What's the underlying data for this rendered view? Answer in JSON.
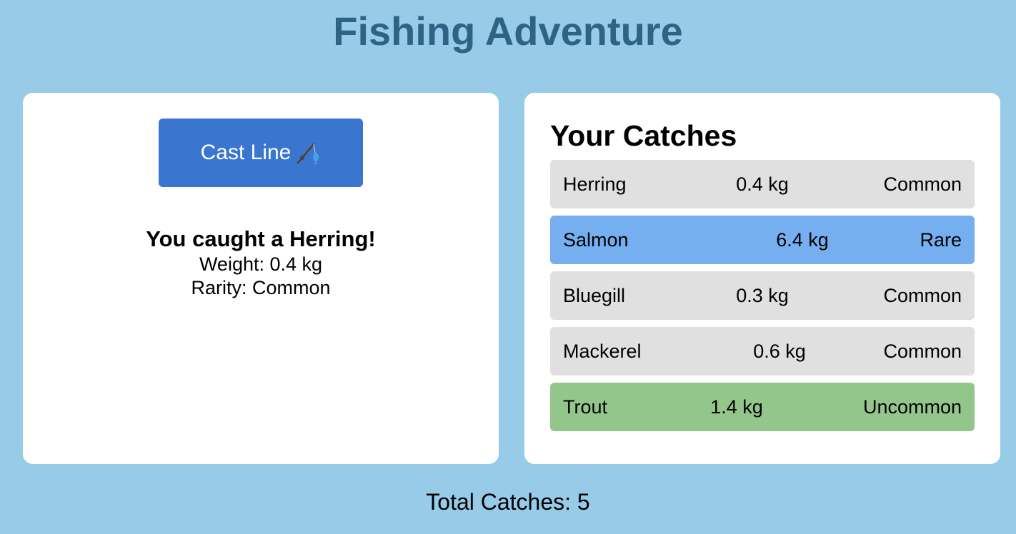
{
  "app": {
    "title": "Fishing Adventure"
  },
  "cast_panel": {
    "button_label": "Cast Line",
    "button_icon": "fishing-rod-icon",
    "button_color": "#3a76d0",
    "result": {
      "heading": "You caught a Herring!",
      "weight_line": "Weight: 0.4 kg",
      "rarity_line": "Rarity: Common"
    }
  },
  "catches_panel": {
    "title": "Your Catches",
    "rarity_colors": {
      "Common": "#e0e0e0",
      "Uncommon": "#93c68a",
      "Rare": "#76afef"
    },
    "items": [
      {
        "name": "Herring",
        "weight": "0.4 kg",
        "rarity": "Common"
      },
      {
        "name": "Salmon",
        "weight": "6.4 kg",
        "rarity": "Rare"
      },
      {
        "name": "Bluegill",
        "weight": "0.3 kg",
        "rarity": "Common"
      },
      {
        "name": "Mackerel",
        "weight": "0.6 kg",
        "rarity": "Common"
      },
      {
        "name": "Trout",
        "weight": "1.4 kg",
        "rarity": "Uncommon"
      }
    ]
  },
  "footer": {
    "total_label": "Total Catches: 5"
  },
  "colors": {
    "background": "#97cbe8",
    "title": "#2e6385",
    "panel": "#ffffff"
  }
}
